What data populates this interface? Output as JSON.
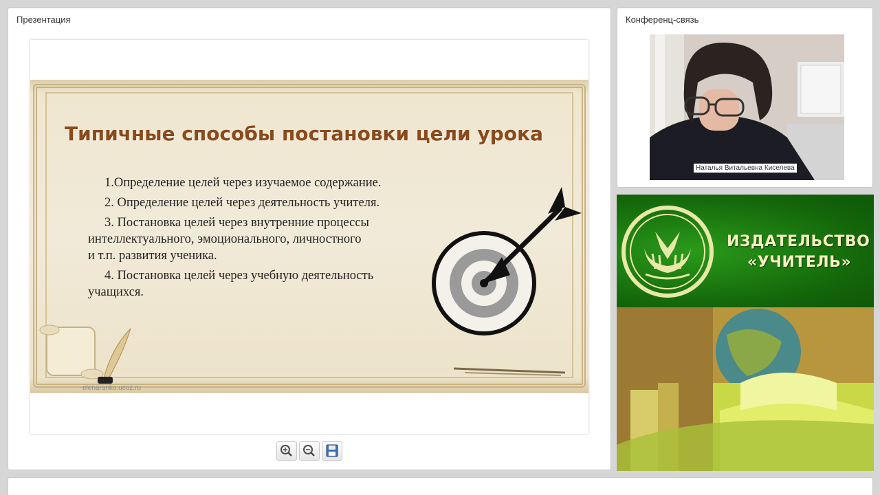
{
  "presentation": {
    "title": "Презентация",
    "slide": {
      "title": "Типичные способы постановки цели урока",
      "items": [
        "1.Определение целей через изучаемое содержание.",
        "2. Определение целей через деятельность учителя.",
        "3. Постановка целей через внутренние процессы",
        "интеллектуального, эмоционального, личностного",
        "и т.п. развития ученика.",
        "4. Постановка целей через учебную деятельность",
        "учащихся."
      ],
      "watermark": "elenaranko.ucoz.ru"
    },
    "toolbar": {
      "zoom_in_icon": "zoom-in-icon",
      "zoom_out_icon": "zoom-out-icon",
      "save_icon": "save-icon"
    }
  },
  "conference": {
    "title": "Конференц-связь",
    "participant_name": "Наталья Витальевна Киселева"
  },
  "publisher": {
    "name_line1": "ИЗДАТЕЛЬСТВО",
    "name_line2": "«УЧИТЕЛЬ»"
  },
  "colors": {
    "slide_title": "#8a4a1c",
    "publisher_green": "#13650a",
    "publisher_text": "#f6f0c0"
  }
}
